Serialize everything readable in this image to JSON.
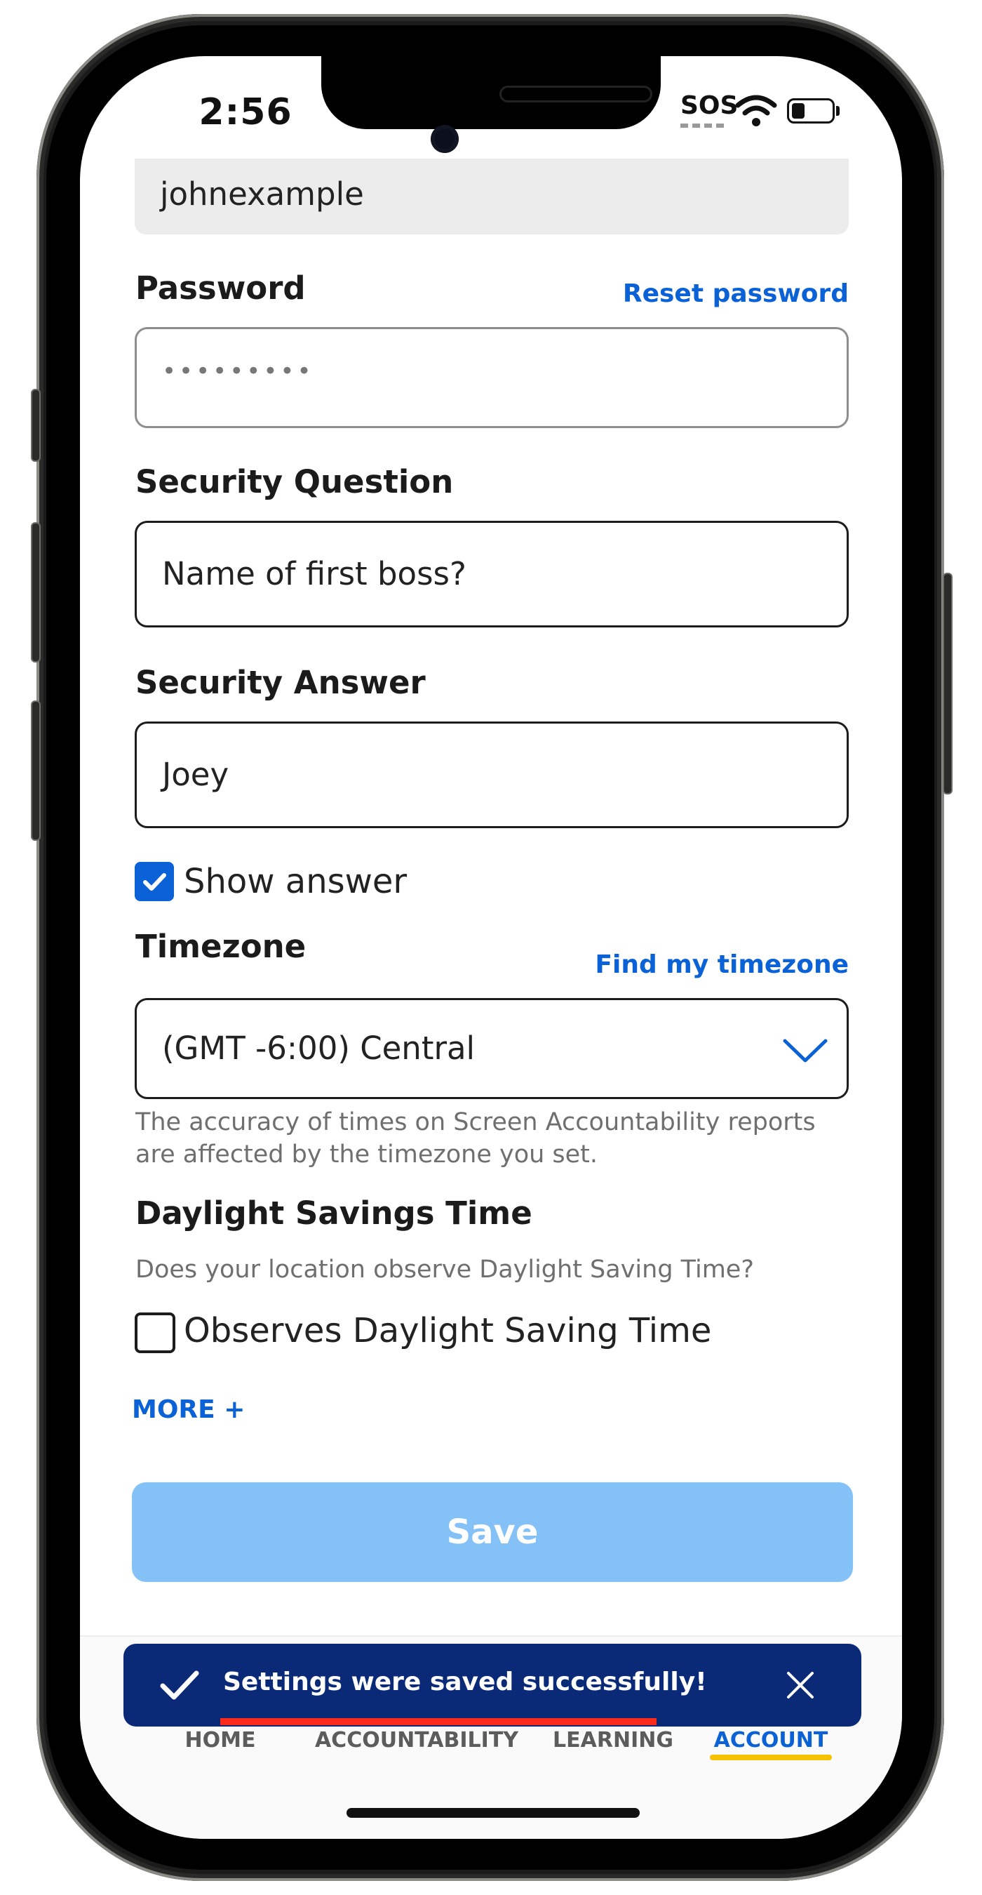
{
  "status_bar": {
    "time": "2:56",
    "sos": "SOS"
  },
  "account": {
    "username_value": "johnexample",
    "password": {
      "label": "Password",
      "reset_link": "Reset password",
      "masked_value": "•••••••••"
    },
    "security_question": {
      "label": "Security Question",
      "value": "Name of first boss?"
    },
    "security_answer": {
      "label": "Security Answer",
      "value": "Joey"
    },
    "show_answer": {
      "label": "Show answer",
      "checked": true
    },
    "timezone": {
      "label": "Timezone",
      "find_link": "Find my timezone",
      "selected": "(GMT -6:00) Central",
      "helper": "The accuracy of times on Screen Accountability reports are affected by the timezone you set."
    },
    "dst": {
      "title": "Daylight Savings Time",
      "question": "Does your location observe Daylight Saving Time?",
      "checkbox_label": "Observes Daylight Saving Time",
      "checked": false
    },
    "more_link": "MORE +",
    "save_label": "Save"
  },
  "toast": {
    "message": "Settings were saved successfully!"
  },
  "tabs": [
    {
      "label": "HOME",
      "active": false
    },
    {
      "label": "ACCOUNTABILITY",
      "active": false
    },
    {
      "label": "LEARNING",
      "active": false
    },
    {
      "label": "ACCOUNT",
      "active": true
    }
  ],
  "colors": {
    "accent_blue": "#0b62d6",
    "save_disabled": "#83c1f6",
    "toast_bg": "#0a2a78",
    "toast_underline": "#ff2a1a",
    "active_tab_underline": "#f6c200"
  }
}
